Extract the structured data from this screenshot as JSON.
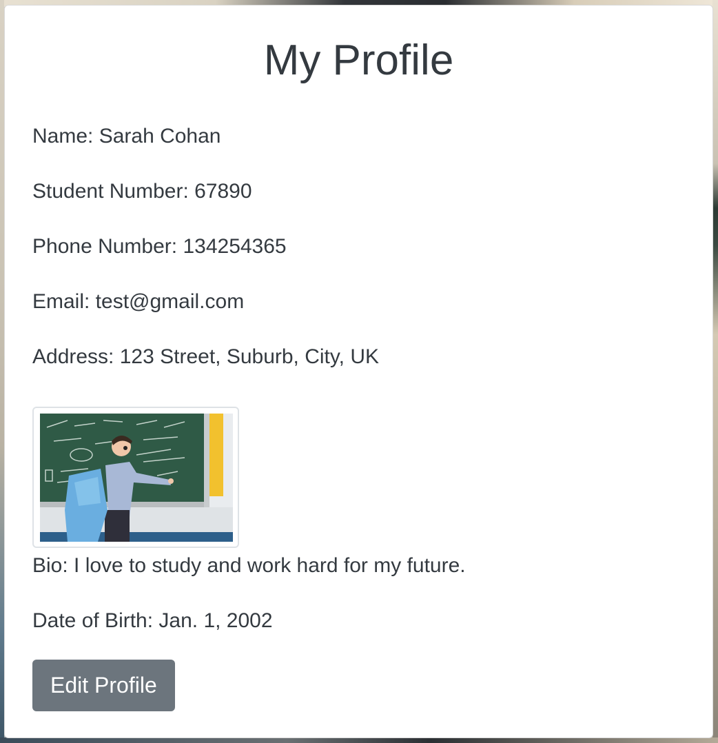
{
  "profile": {
    "title": "My Profile",
    "name_label": "Name: Sarah Cohan",
    "student_number_label": "Student Number: 67890",
    "phone_number_label": "Phone Number: 134254365",
    "email_label": "Email: test@gmail.com",
    "address_label": "Address: 123 Street, Suburb, City, UK",
    "bio_label": "Bio: I love to study and work hard for my future.",
    "dob_label": "Date of Birth: Jan. 1, 2002",
    "edit_button_label": "Edit Profile"
  },
  "colors": {
    "text": "#343a40",
    "button_bg": "#6c757d",
    "button_text": "#ffffff",
    "card_bg": "#ffffff"
  }
}
